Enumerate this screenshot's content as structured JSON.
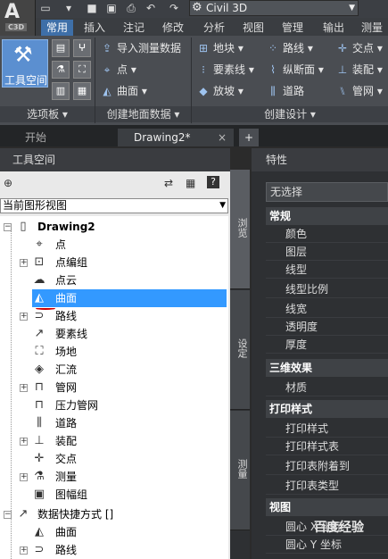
{
  "app": {
    "logo_letter": "A",
    "logo_badge": "C3D"
  },
  "quick_access": {
    "icons": [
      "new-file-icon",
      "open-icon",
      "save-icon",
      "save-as-icon",
      "plot-icon",
      "undo-icon",
      "redo-icon"
    ]
  },
  "workspace": {
    "label": "Civil 3D"
  },
  "ribbon_tabs": [
    "常用",
    "插入",
    "注记",
    "修改",
    "分析",
    "视图",
    "管理",
    "输出",
    "测量"
  ],
  "ribbon": {
    "toolspace_label": "工具空间",
    "palettes_label": "选项板",
    "create_ground_label": "创建地面数据",
    "create_design_label": "创建设计",
    "commands": {
      "import_survey": "导入测量数据",
      "point": "点",
      "surface": "曲面",
      "parcel": "地块",
      "feature_line": "要素线",
      "grading": "放坡",
      "alignment": "路线",
      "profile": "纵断面",
      "corridor": "道路",
      "intersection": "交点",
      "assembly": "装配",
      "pipe_network": "管网"
    }
  },
  "doc_tabs": {
    "start": "开始",
    "drawing": "Drawing2*",
    "close": "×",
    "add": "+"
  },
  "toolspace": {
    "title": "工具空间",
    "view_select": "当前图形视图",
    "tree": {
      "root": "Drawing2",
      "items": [
        "点",
        "点编组",
        "点云",
        "曲面",
        "路线",
        "要素线",
        "场地",
        "汇流",
        "管网",
        "压力管网",
        "道路",
        "装配",
        "交点",
        "测量",
        "图幅组"
      ],
      "shortcuts": "数据快捷方式 []",
      "shortcut_items": [
        "曲面",
        "路线"
      ]
    }
  },
  "side_tabs": [
    "浏览",
    "设定",
    "测量"
  ],
  "properties": {
    "title": "特性",
    "no_selection": "无选择",
    "sections": [
      {
        "name": "常规",
        "rows": [
          "颜色",
          "图层",
          "线型",
          "线型比例",
          "线宽",
          "透明度",
          "厚度"
        ]
      },
      {
        "name": "三维效果",
        "rows": [
          "材质"
        ]
      },
      {
        "name": "打印样式",
        "rows": [
          "打印样式",
          "打印样式表",
          "打印表附着到",
          "打印表类型"
        ]
      },
      {
        "name": "视图",
        "rows": [
          "圆心 X 坐标",
          "圆心 Y 坐标"
        ]
      }
    ]
  },
  "watermark": {
    "text": "百度经验"
  },
  "colors": {
    "accent": "#3e6fa8",
    "selection": "#3399ff",
    "annotation": "#cc0000"
  }
}
